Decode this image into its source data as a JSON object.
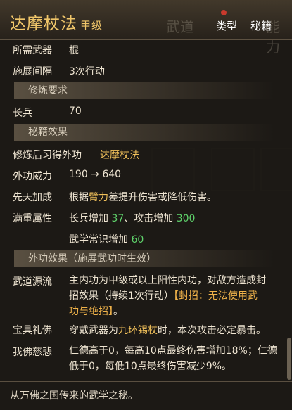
{
  "header": {
    "title": "达摩杖法",
    "grade": "甲级",
    "type_label": "类型",
    "type_value": "秘籍",
    "ghost_tab_1": "武道",
    "ghost_tab_2": "能力"
  },
  "info": {
    "weapon_label": "所需武器",
    "weapon_value": "棍",
    "interval_label": "施展间隔",
    "interval_value": "3次行动"
  },
  "requirements": {
    "header": "修炼要求",
    "skill_label": "长兵",
    "skill_value": "70"
  },
  "effects": {
    "header": "秘籍效果",
    "learn_label": "修炼后习得外功",
    "learn_value": "达摩杖法",
    "power_label": "外功威力",
    "power_value": "190 → 640",
    "innate_label": "先天加成",
    "innate_prefix": "根据",
    "innate_highlight": "臂力",
    "innate_suffix": "差提升伤害或降低伤害。",
    "full_label": "满重属性",
    "full_a_prefix": "长兵增加 ",
    "full_a_val": "37",
    "full_b_prefix": "、攻击增加 ",
    "full_b_val": "300",
    "full_c_prefix": "武学常识增加 ",
    "full_c_val": "60"
  },
  "outer": {
    "header": "外功效果（施展武功时生效）",
    "wudao_label": "武道源流",
    "wudao_text_1": "主内功为甲级或以上阳性内功，对敌方造成封",
    "wudao_text_2a": "招效果（持续1次行动）",
    "wudao_text_2b": "【封招：无法使用武",
    "wudao_text_3a": "功与绝招】",
    "wudao_text_3b": "。",
    "treasure_label": "宝具礼佛",
    "treasure_prefix": "穿戴武器为",
    "treasure_item": "九环锡杖",
    "treasure_suffix": "时，本次攻击必定暴击。",
    "buddha_label": "我佛慈悲",
    "buddha_text_1": "仁德高于0，每高10点最终伤害增加18%；仁德",
    "buddha_text_2": "低于0，每低10点最终伤害减少9%。"
  },
  "footer": {
    "flavor": "从万佛之国传来的武学之秘。"
  },
  "colors": {
    "gold": "#f0c05a",
    "green": "#5fd36b",
    "background": "#1b1814"
  }
}
